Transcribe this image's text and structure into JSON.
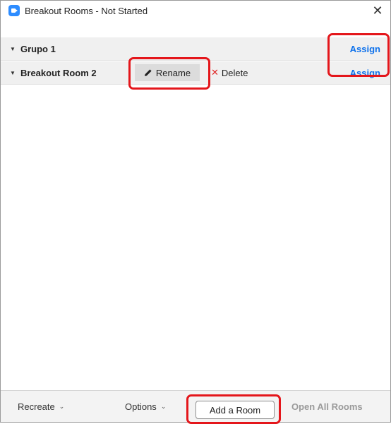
{
  "window": {
    "title": "Breakout Rooms - Not Started",
    "close_glyph": "✕"
  },
  "rooms": [
    {
      "name": "Grupo 1",
      "assign_label": "Assign"
    },
    {
      "name": "Breakout Room 2",
      "assign_label": "Assign",
      "rename_label": "Rename",
      "delete_label": "Delete"
    }
  ],
  "footer": {
    "recreate_label": "Recreate",
    "options_label": "Options",
    "add_room_label": "Add a Room",
    "open_all_label": "Open All Rooms"
  },
  "colors": {
    "accent": "#0e71eb",
    "highlight": "#e4161b",
    "zoom_blue": "#2d8cff"
  }
}
